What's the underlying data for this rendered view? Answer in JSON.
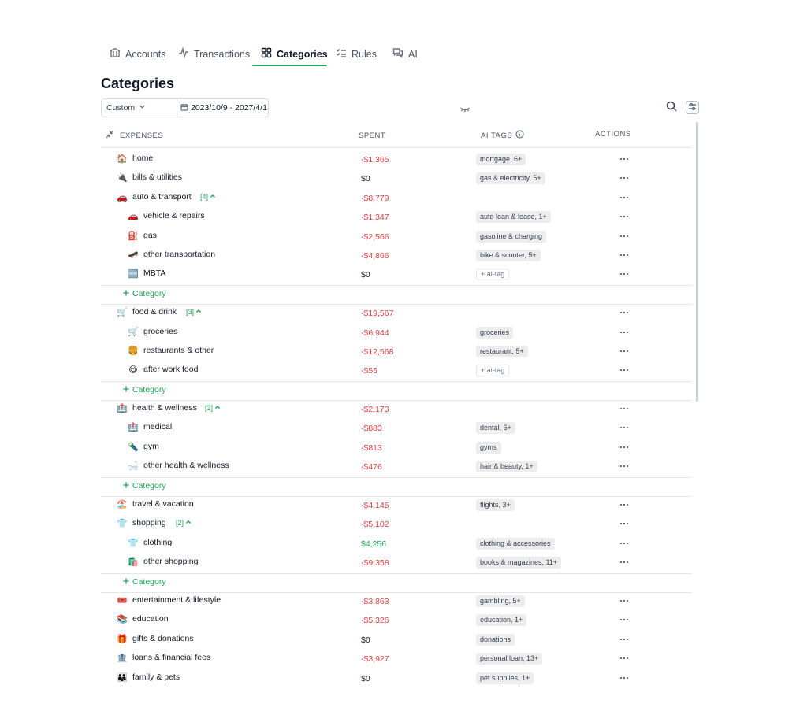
{
  "tabs": [
    {
      "label": "Accounts",
      "icon": "bank-icon"
    },
    {
      "label": "Transactions",
      "icon": "pulse-icon"
    },
    {
      "label": "Categories",
      "icon": "grid-icon",
      "active": true
    },
    {
      "label": "Rules",
      "icon": "checklist-icon"
    },
    {
      "label": "AI",
      "icon": "chat-icon"
    }
  ],
  "page": {
    "title": "Categories"
  },
  "toolbar": {
    "range": "Custom",
    "dates": "2023/10/9 - 2027/4/1"
  },
  "table": {
    "headers": {
      "expenses": "EXPENSES",
      "spent": "SPENT",
      "ai_tags": "AI TAGS",
      "actions": "ACTIONS"
    },
    "add_label": "Category",
    "rows": [
      {
        "kind": "cat",
        "emoji": "🏠",
        "name": "home",
        "spent": "-$1,365",
        "tag": "mortgage, 6+"
      },
      {
        "kind": "cat",
        "emoji": "🔌",
        "name": "bills & utilities",
        "spent": "$0",
        "tag": "gas & electricity, 5+"
      },
      {
        "kind": "group",
        "emoji": "🚗",
        "name": "auto & transport",
        "count": "[4]",
        "spent": "-$8,779"
      },
      {
        "kind": "sub",
        "emoji": "🚗",
        "name": "vehicle & repairs",
        "spent": "-$1,347",
        "tag": "auto loan & lease, 1+"
      },
      {
        "kind": "sub",
        "emoji": "⛽",
        "name": "gas",
        "spent": "-$2,566",
        "tag": "gasoline & charging"
      },
      {
        "kind": "sub",
        "emoji": "🛹",
        "name": "other transportation",
        "spent": "-$4,866",
        "tag": "bike & scooter, 5+"
      },
      {
        "kind": "sub",
        "emoji": "🆕",
        "name": "MBTA",
        "spent": "$0",
        "tag": "+ ai-tag",
        "tag_outline": true
      },
      {
        "kind": "add"
      },
      {
        "kind": "group",
        "emoji": "🛒",
        "name": "food & drink",
        "count": "[3]",
        "spent": "-$19,567"
      },
      {
        "kind": "sub",
        "emoji": "🛒",
        "name": "groceries",
        "spent": "-$6,944",
        "tag": "groceries"
      },
      {
        "kind": "sub",
        "emoji": "🍔",
        "name": "restaurants & other",
        "spent": "-$12,568",
        "tag": "restaurant, 5+"
      },
      {
        "kind": "sub",
        "emoji": "😋",
        "name": "after work food",
        "spent": "-$55",
        "tag": "+ ai-tag",
        "tag_outline": true
      },
      {
        "kind": "add"
      },
      {
        "kind": "group",
        "emoji": "🏥",
        "name": "health & wellness",
        "count": "[3]",
        "spent": "-$2,173"
      },
      {
        "kind": "sub",
        "emoji": "🏥",
        "name": "medical",
        "spent": "-$883",
        "tag": "dental, 6+"
      },
      {
        "kind": "sub",
        "emoji": "🔦",
        "name": "gym",
        "spent": "-$813",
        "tag": "gyms"
      },
      {
        "kind": "sub",
        "emoji": "🛁",
        "name": "other health & wellness",
        "spent": "-$476",
        "tag": "hair & beauty, 1+"
      },
      {
        "kind": "add"
      },
      {
        "kind": "cat",
        "emoji": "🏖️",
        "name": "travel & vacation",
        "spent": "-$4,145",
        "tag": "flights, 3+"
      },
      {
        "kind": "group",
        "emoji": "👕",
        "name": "shopping",
        "count": "[2]",
        "spent": "-$5,102"
      },
      {
        "kind": "sub",
        "emoji": "👕",
        "name": "clothing",
        "spent": "$4,256",
        "tag": "clothing & accessories"
      },
      {
        "kind": "sub",
        "emoji": "🛍️",
        "name": "other shopping",
        "spent": "-$9,358",
        "tag": "books & magazines, 11+"
      },
      {
        "kind": "add"
      },
      {
        "kind": "cat",
        "emoji": "🎟️",
        "name": "entertainment & lifestyle",
        "spent": "-$3,863",
        "tag": "gambling, 5+"
      },
      {
        "kind": "cat",
        "emoji": "📚",
        "name": "education",
        "spent": "-$5,326",
        "tag": "education, 1+"
      },
      {
        "kind": "cat",
        "emoji": "🎁",
        "name": "gifts & donations",
        "spent": "$0",
        "tag": "donations"
      },
      {
        "kind": "cat",
        "emoji": "🏦",
        "name": "loans & financial fees",
        "spent": "-$3,927",
        "tag": "personal loan, 13+"
      },
      {
        "kind": "cat",
        "emoji": "👪",
        "name": "family & pets",
        "spent": "$0",
        "tag": "pet supplies, 1+"
      }
    ]
  }
}
